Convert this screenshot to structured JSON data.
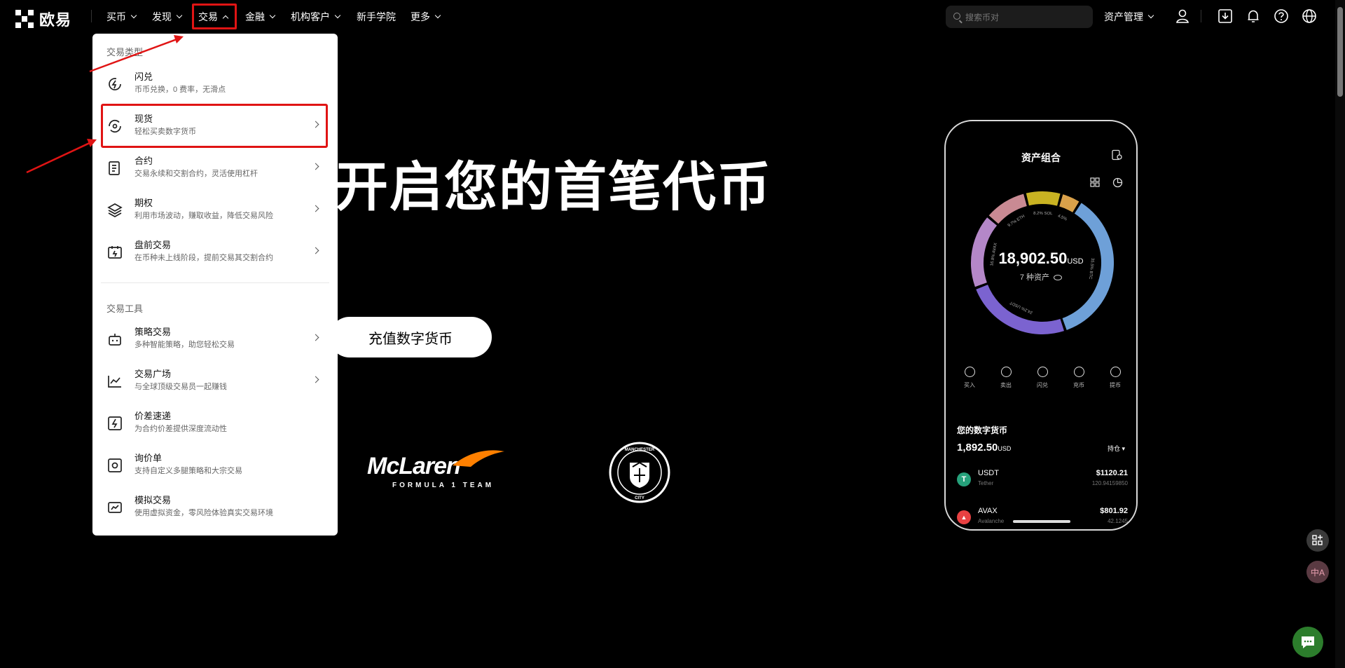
{
  "brand": {
    "name": "欧易"
  },
  "nav": {
    "items": [
      "买币",
      "发现",
      "交易",
      "金融",
      "机构客户",
      "新手学院",
      "更多"
    ],
    "active": "交易"
  },
  "search": {
    "placeholder": "搜索币对"
  },
  "header_right": {
    "assets_label": "资产管理"
  },
  "hero": {
    "title": "开启您的首笔代币",
    "deposit_button": "充值数字货币"
  },
  "partners": {
    "mclaren_name": "McLaren",
    "mclaren_sub": "FORMULA 1 TEAM",
    "city_text": "MANCHESTER CITY"
  },
  "dropdown": {
    "section1_title": "交易类型",
    "section2_title": "交易工具",
    "trade_types": [
      {
        "label": "闪兑",
        "desc": "币币兑换，0 费率，无滑点",
        "arrow": false,
        "icon": "flash-swap-icon"
      },
      {
        "label": "现货",
        "desc": "轻松买卖数字货币",
        "arrow": true,
        "icon": "spot-icon"
      },
      {
        "label": "合约",
        "desc": "交易永续和交割合约，灵活使用杠杆",
        "arrow": true,
        "icon": "contract-icon"
      },
      {
        "label": "期权",
        "desc": "利用市场波动，赚取收益，降低交易风险",
        "arrow": true,
        "icon": "options-icon"
      },
      {
        "label": "盘前交易",
        "desc": "在币种未上线阶段，提前交易其交割合约",
        "arrow": true,
        "icon": "pre-market-icon"
      }
    ],
    "tools": [
      {
        "label": "策略交易",
        "desc": "多种智能策略，助您轻松交易",
        "arrow": true,
        "icon": "bot-icon"
      },
      {
        "label": "交易广场",
        "desc": "与全球顶级交易员一起赚钱",
        "arrow": true,
        "icon": "copy-trading-icon"
      },
      {
        "label": "价差速递",
        "desc": "为合约价差提供深度流动性",
        "arrow": false,
        "icon": "spread-icon"
      },
      {
        "label": "询价单",
        "desc": "支持自定义多腿策略和大宗交易",
        "arrow": false,
        "icon": "rfq-icon"
      },
      {
        "label": "模拟交易",
        "desc": "使用虚拟资金，零风险体验真实交易环境",
        "arrow": false,
        "icon": "demo-trading-icon"
      }
    ]
  },
  "phone": {
    "title": "资产组合",
    "total": "18,902.50",
    "currency": "USD",
    "asset_count": "7 种资产",
    "donut_segments": [
      {
        "label": "35.5% BTC",
        "pct": 35.5,
        "color": "#6ea0d8"
      },
      {
        "label": "24.2% USDT",
        "pct": 24.2,
        "color": "#7b63d0"
      },
      {
        "label": "16.8% AVAX",
        "pct": 16.8,
        "color": "#b487c8"
      },
      {
        "label": "9.7% ETH",
        "pct": 9.7,
        "color": "#c98a93"
      },
      {
        "label": "8.2% SOL",
        "pct": 8.2,
        "color": "#c9b322"
      },
      {
        "label": "4.5%",
        "pct": 4.5,
        "color": "#d9a14a"
      }
    ],
    "actions": [
      "买入",
      "卖出",
      "闪兑",
      "充币",
      "提币"
    ],
    "section_title": "您的数字货币",
    "holdings_total": "1,892.50",
    "holdings_currency": "USD",
    "filter": "持仓",
    "assets": [
      {
        "symbol": "USDT",
        "name": "Tether",
        "value": "$1120.21",
        "amount": "120.94159850",
        "color": "#26a17b",
        "glyph": "T"
      },
      {
        "symbol": "AVAX",
        "name": "Avalanche",
        "value": "$801.92",
        "amount": "42.1245",
        "color": "#e84142",
        "glyph": "▲"
      }
    ]
  },
  "float": {
    "lang_label": "中A"
  }
}
